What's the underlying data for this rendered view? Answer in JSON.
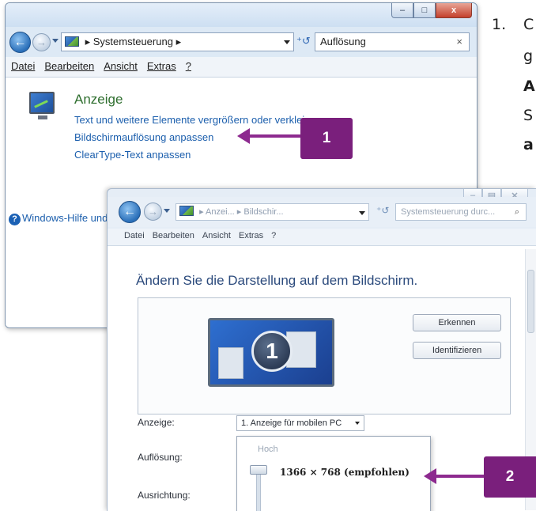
{
  "instruction": {
    "number": "1.",
    "line1": "C",
    "line2": "g",
    "line3": "A",
    "line4": "S",
    "line5": "a"
  },
  "back_window": {
    "caption_buttons": {
      "minimize": "–",
      "maximize": "□",
      "close": "x"
    },
    "address": {
      "crumb": "Systemsteuerung"
    },
    "search": {
      "value": "Auflösung",
      "clear": "×"
    },
    "menu": [
      "Datei",
      "Bearbeiten",
      "Ansicht",
      "Extras",
      "?"
    ],
    "result": {
      "title": "Anzeige",
      "links": [
        "Text und weitere Elemente vergrößern oder verkleinern",
        "Bildschirmauflösung anpassen",
        "ClearType-Text anpassen"
      ]
    },
    "help_link": "Windows-Hilfe und Support"
  },
  "callouts": {
    "first": "1",
    "second": "2"
  },
  "front_window": {
    "address": {
      "crumb1": "Anzei...",
      "crumb2": "Bildschir..."
    },
    "search_placeholder": "Systemsteuerung durc...",
    "menu": [
      "Datei",
      "Bearbeiten",
      "Ansicht",
      "Extras",
      "?"
    ],
    "heading": "Ändern Sie die Darstellung auf dem Bildschirm.",
    "monitor_number": "1",
    "buttons": {
      "detect": "Erkennen",
      "identify": "Identifizieren"
    },
    "labels": {
      "display": "Anzeige:",
      "resolution": "Auflösung:",
      "orientation": "Ausrichtung:"
    },
    "display_select_value": "1. Anzeige für mobilen PC",
    "resolution_popup": {
      "high_label": "Hoch",
      "value": "1366 × 768 (empfohlen)"
    }
  }
}
